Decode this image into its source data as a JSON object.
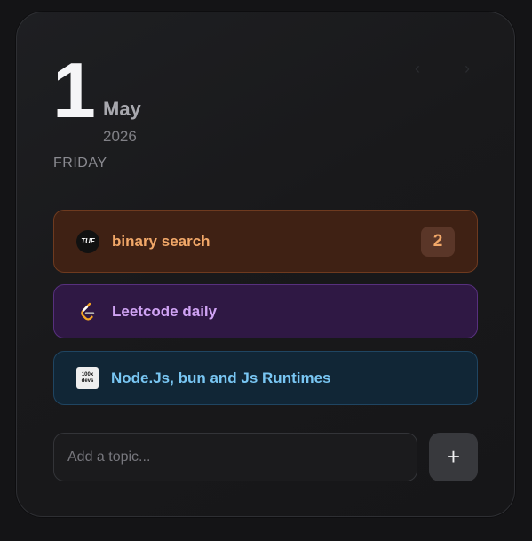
{
  "date": {
    "day": "1",
    "month": "May",
    "year": "2026",
    "weekday": "FRIDAY"
  },
  "nav": {
    "prev_icon": "chevron-left-icon",
    "next_icon": "chevron-right-icon",
    "prev_glyph": "‹",
    "next_glyph": "›"
  },
  "topics": [
    {
      "label": "binary search",
      "icon": "tuf-logo-icon",
      "icon_text": "TUF",
      "count": "2",
      "color": "#f2a869"
    },
    {
      "label": "Leetcode daily",
      "icon": "leetcode-icon",
      "color": "#d0a3f4"
    },
    {
      "label": "Node.Js, bun and Js Runtimes",
      "icon": "100x-devs-icon",
      "icon_text_top": "100x",
      "icon_text_bottom": "devs",
      "color": "#79c6f3"
    }
  ],
  "input": {
    "placeholder": "Add a topic...",
    "value": ""
  },
  "add_button": {
    "glyph": "+",
    "icon": "plus-icon"
  }
}
